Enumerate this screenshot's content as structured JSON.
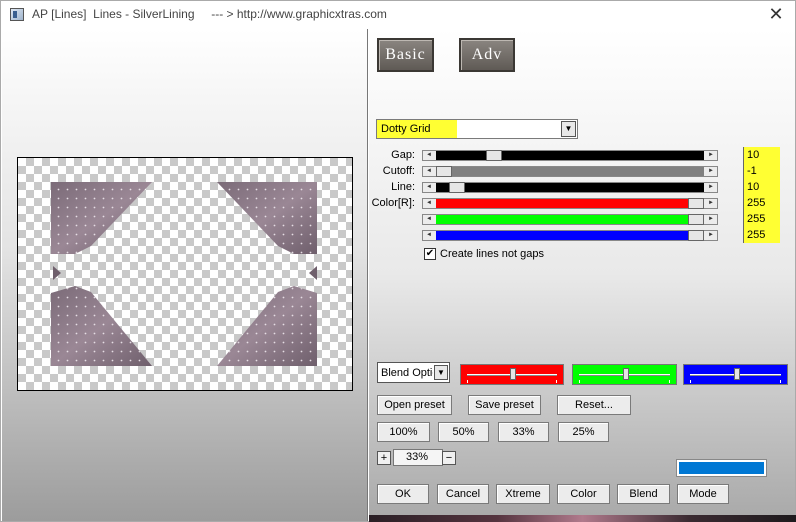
{
  "window": {
    "title": "AP [Lines]  Lines - SilverLining     --- > http://www.graphicxtras.com",
    "close_glyph": "✕"
  },
  "tabs": {
    "basic": "Basic",
    "adv": "Adv"
  },
  "preset": {
    "selected": "Dotty Grid",
    "highlight_color": "#ffff33"
  },
  "params": [
    {
      "label": "Gap:",
      "value": "10",
      "fill_color": "#000000",
      "thumb_fraction": 0.2
    },
    {
      "label": "Cutoff:",
      "value": "-1",
      "fill_color": "#808080",
      "thumb_fraction": 0.0
    },
    {
      "label": "Line:",
      "value": "10",
      "fill_color": "#000000",
      "thumb_fraction": 0.05
    },
    {
      "label": "Color[R]:",
      "value": "255",
      "fill_color": "#ff0000",
      "thumb_fraction": 1.0
    },
    {
      "label": "",
      "value": "255",
      "fill_color": "#00ff00",
      "thumb_fraction": 1.0
    },
    {
      "label": "",
      "value": "255",
      "fill_color": "#0000ff",
      "thumb_fraction": 1.0
    }
  ],
  "checkbox": {
    "label": "Create lines not gaps",
    "checked": true,
    "mark": "✔"
  },
  "blend": {
    "selected": "Blend Options"
  },
  "color_sliders": [
    {
      "name": "red",
      "color": "#ff0000",
      "fraction": 0.5
    },
    {
      "name": "green",
      "color": "#00ff00",
      "fraction": 0.5
    },
    {
      "name": "blue",
      "color": "#0000ff",
      "fraction": 0.5
    }
  ],
  "preset_buttons": {
    "open": "Open preset",
    "save": "Save preset",
    "reset": "Reset..."
  },
  "zoom_buttons": [
    "100%",
    "50%",
    "33%",
    "25%"
  ],
  "zoom": {
    "value": "33%",
    "plus": "+",
    "minus": "−"
  },
  "swatch_color": "#0078d4",
  "bottom_buttons": [
    "OK",
    "Cancel",
    "Xtreme",
    "Color",
    "Blend",
    "Mode"
  ]
}
